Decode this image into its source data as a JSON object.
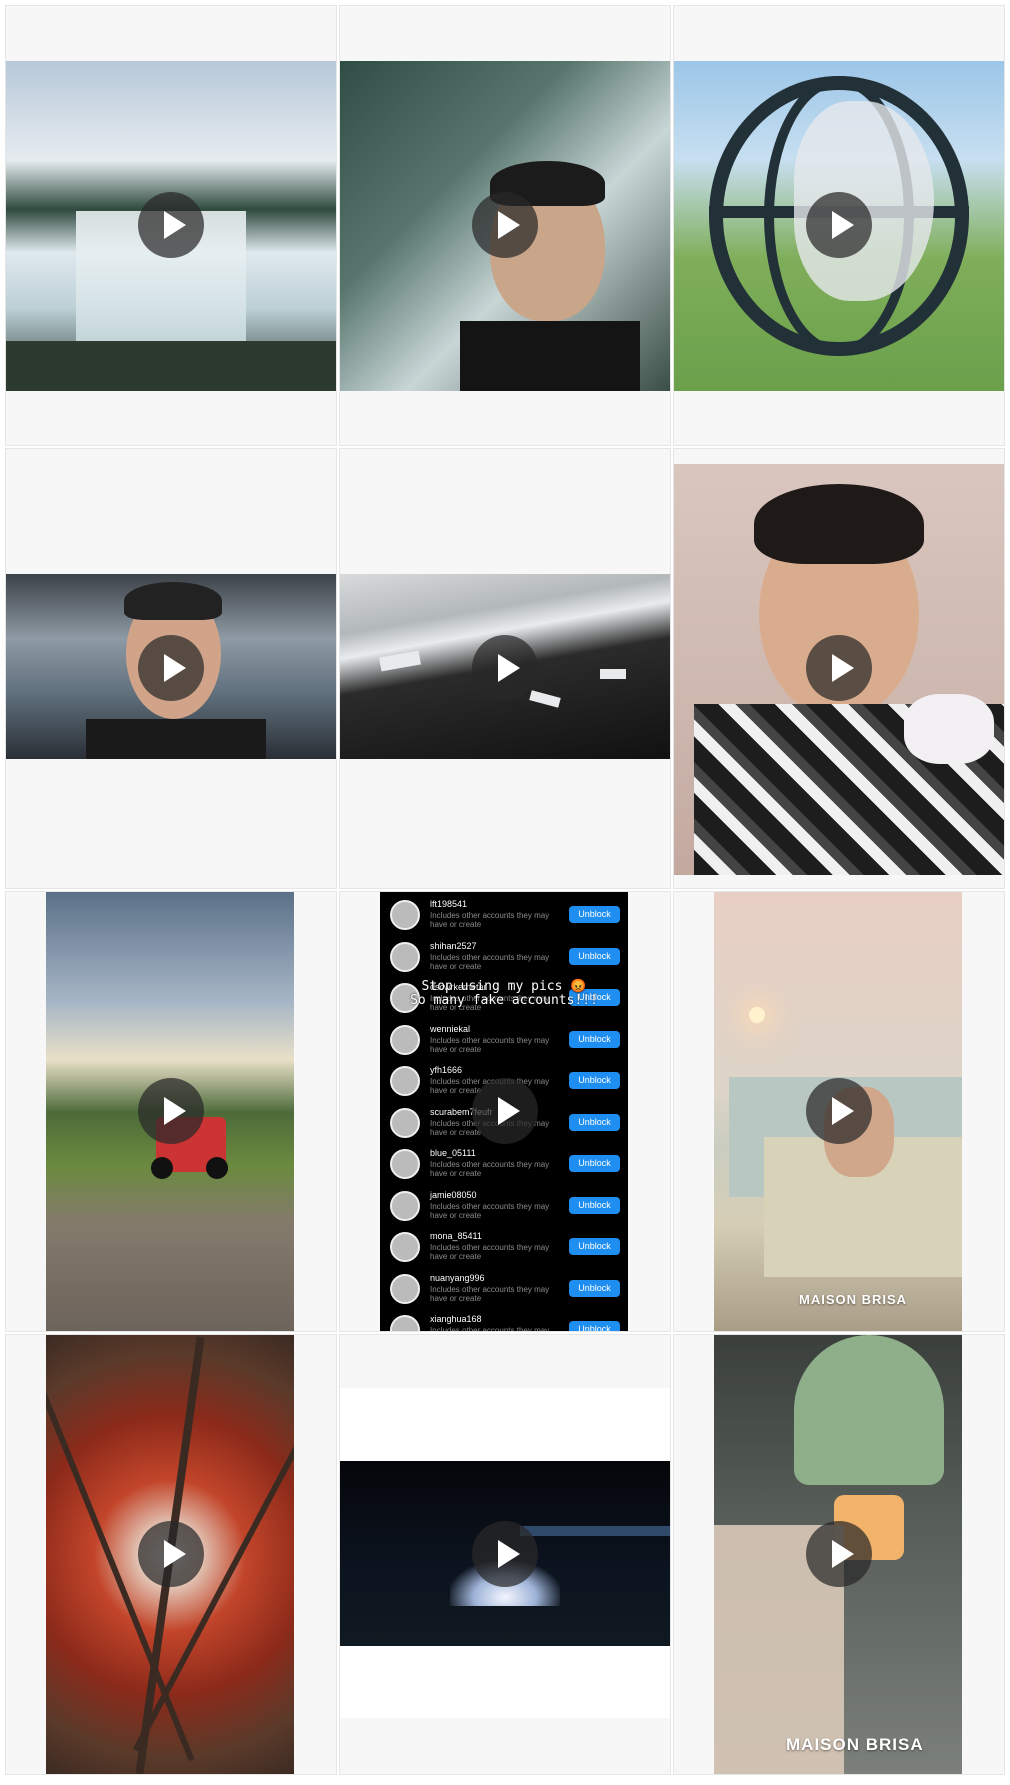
{
  "grid": {
    "posts": [
      {
        "type": "video",
        "description_icon": "play-icon"
      },
      {
        "type": "video",
        "description_icon": "play-icon"
      },
      {
        "type": "video",
        "description_icon": "play-icon"
      },
      {
        "type": "video",
        "description_icon": "play-icon"
      },
      {
        "type": "video",
        "description_icon": "play-icon"
      },
      {
        "type": "video",
        "description_icon": "play-icon"
      },
      {
        "type": "video",
        "description_icon": "play-icon"
      },
      {
        "type": "video",
        "description_icon": "play-icon"
      },
      {
        "type": "video",
        "description_icon": "play-icon",
        "watermark": "MAISON BRISA"
      },
      {
        "type": "video",
        "description_icon": "play-icon"
      },
      {
        "type": "video",
        "description_icon": "play-icon"
      },
      {
        "type": "video",
        "description_icon": "play-icon",
        "watermark": "MAISON BRISA"
      }
    ]
  },
  "blocklist_post": {
    "overlay_line1": "Stop using my pics 😡",
    "overlay_line2": "So many fake accounts!!!",
    "unblock_label": "Unblock",
    "subtext": "Includes other accounts they may have or create",
    "accounts": [
      "lft198541",
      "shihan2527",
      "dscwrkernetar",
      "wenniekal",
      "yfh1666",
      "scurabem7feufr",
      "blue_05111",
      "jamie08050",
      "mona_85411",
      "nuanyang996",
      "xianghua168"
    ]
  },
  "colors": {
    "cell_background": "#f7f7f7",
    "unblock_button": "#1f8ef1"
  }
}
